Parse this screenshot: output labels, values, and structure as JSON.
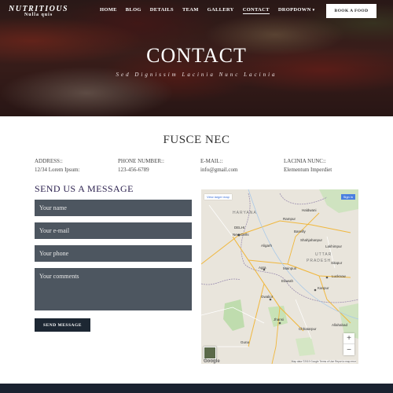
{
  "brand": {
    "title": "NUTRITIOUS",
    "subtitle": "Nulla quis"
  },
  "nav": {
    "items": [
      {
        "label": "HOME"
      },
      {
        "label": "BLOG"
      },
      {
        "label": "DETAILS"
      },
      {
        "label": "TEAM"
      },
      {
        "label": "GALLERY"
      },
      {
        "label": "CONTACT",
        "active": true
      },
      {
        "label": "DROPDOWN"
      }
    ],
    "cta_label": "BOOK A FOOD"
  },
  "hero": {
    "title": "CONTACT",
    "subtitle": "Sed Dignissim Lacinia Nunc Lacinia"
  },
  "section_title": "FUSCE NEC",
  "info": [
    {
      "key": "ADDRESS::",
      "value": "12/34 Lorem Ipsum:"
    },
    {
      "key": "PHONE NUMBER::",
      "value": "123-456-6789"
    },
    {
      "key": "E-MAIL::",
      "value": "info@gmail.com"
    },
    {
      "key": "LACINIA NUNC::",
      "value": "Elementum Imperdiet"
    }
  ],
  "form": {
    "title": "SEND US A MESSAGE",
    "name_placeholder": "Your name",
    "email_placeholder": "Your e-mail",
    "phone_placeholder": "Your phone",
    "comments_placeholder": "Your comments",
    "submit_label": "SEND MESSAGE"
  },
  "map": {
    "view_larger": "View larger map",
    "sign_in": "Sign in",
    "labels": {
      "haryana": "HARYANA",
      "delhi": "DELHI",
      "new_delhi": "New Delhi",
      "uttar": "UTTAR",
      "pradesh": "PRADESH",
      "agra": "Agra",
      "gwalior": "Gwalior",
      "lucknow": "Lucknow",
      "kanpur": "Kanpur",
      "aligarh": "Aligarh",
      "bareilly": "Bareilly",
      "haldwani": "Haldwani",
      "jhansi": "Jhansi",
      "guna": "Guna",
      "chhatarpur": "Chhatarpur",
      "rampur": "Rampur",
      "lakhimpur": "Lakhimpur",
      "shahjahanpur": "Shahjahanpur",
      "sitapur": "Sitapur",
      "mainpuri": "Mainpuri",
      "etawah": "Etawah",
      "allahabad": "Allahabad"
    },
    "google": "Google",
    "attribution": "Map data ©2019 Google   Terms of Use   Report a map error"
  },
  "colors": {
    "field_bg": "#4d5660",
    "button_dark": "#1d2733",
    "form_title": "#2a1f4d",
    "footer": "#1a2230"
  }
}
